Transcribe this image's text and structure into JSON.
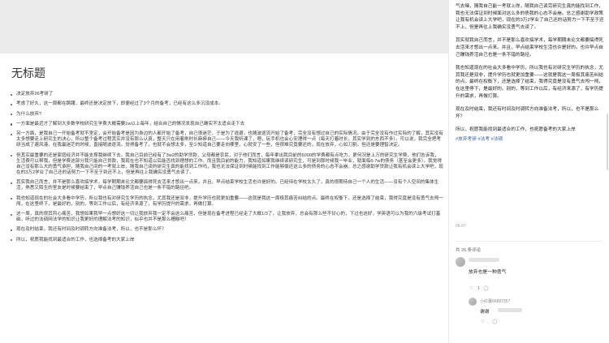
{
  "note": {
    "title": "无标题",
    "items": [
      "决定放弃26考研了",
      "考虑了好久，这一周都在踌躇，最终还是决定放下，即便经过了3个月的备考，已经有这么多沉没成本。",
      "为什么放弃?",
      "一方面是最近才了解到大多数学校研究生学费大概需要1w以上每年，结合自己的情况发现自己确实不太适合走下去",
      "另一方面，是我自己一开始备考就不坚定，会开始备考是因为身边的人都开始了备考，自己很迷茫，于是为了逃避，也随波逐流开始了备考，完全没有想过自己的实际情况。由于完全没有作过实际的了解，其实没有太多想要走上研究生的决心，所以整个备考过程其实并没有那么认真，整天只在用着刷时长麻痹自己——今天我听课了，嗯，玩手机也会心安理得一点（每天打着时长，其实学到的东西不多）。可以说，我完全把考研当成了避风港，在我最迷茫的时候，直接随波逐流。觉得备考了，也就不会想太多，至少知道自己要走向哪里，心就安了一些，但很难究竟要还的，现在放弃，心如刀割，但还是要理智决定。",
      "但其实最重要的还是家庭经济并不能支撑我继续下去。我自己目前已经有了3w2的助学贷款，父母都是农民，对于他们而言，每年拿出我目前的6000的学费都有点吃力，更何况是上万的研究生学费，他们告诉我，生活费可以帮我，但是学费这部分我只能自己贷款，我现在也不知道以后能否找到理想的工作。而且我目前的能力，我知道如果我继续读研究生，可是到那时候我一毕业，就面临6-7w的债务（甚至会更多）。我觉得自己没有那么大的勇气承担，随我自己间的一考就上岸，随我自己读的研究生真的能找到工作吗，我也无法保证到时候能找到工作能够偿还这么多的债务的心态不会崩。总之感谢助学贷款让我有机会读上大学吧，现在的3万2学业了自己还的话努力一下不至于到还不上，但是再往上我确实没勇气去读了。",
      "其实我自己而言，并不是那么喜欢搞学术，每学期期末论文都要搞得死去活来才憋出一点来。并且，早点结束学校生活也许是好的。已经待在学校太久了，真的很期待自己一个人的生活——没有个人空间的集体生活，熟悉又陌生的室友是时候要结束了，早点自己赚钱养活自己也是一条不错的路径吧。",
      "我也知道现在的社会大多看中学历，所以我也有对研究生学历的执念，尤其我还是双非，提升学历也就更加重要——这就是我这一周极其痛苦纠结的点。最终在权衡下，还是选择了结束，我得究竟是没有勇气去闯一闯，在这里终下，是最好的，别的，等到工作以后，有经济来源了，有学历提升的需求，再做打算。",
      "这一周，真的很其煎心痛苦，我想如果我早一点想好这一切让我放弃我一定不会这么痛苦，但是现在备考进程已经走了大概1/3了，让我放弃，总会有那么些不甘心的，下过也这好，学英语可以为我的六级考试打基础，听过的法硕网法学的知识让我更好的理解法考的知识，似乎也并不是那么槽糕吧！",
      "现在及时结束，我还有时间及时调转方向准备法考，所以，也不是那么坏？",
      "所以，祝愿我能找到最适合的工作，也选择备考的大家上岸"
    ]
  },
  "post": {
    "paragraphs": [
      "气去赌，随我自己能一考就上岸，随我自己读完研究生真的能找到工作，我也无法保证到时候面对这么多的债我的心态不会崩。总之感谢助学政策让我有机会读上大学吧，现在的3万2学业了自己还的话努力一下不至于还不上，但是再往上我确实没勇气去读了。",
      "其实就我自己而言，并不是那么喜欢搞学术，每学期期末论文都要搞得死去活来才憋出一点来。并且，早点结束学校生活也许是好的。也许早点自己赚钱养活自己也是一条不错的路径。",
      "我也知道现在的社会大多看中学历，所以我也有对研究生学历的执念，尤其我还是双非，提升学历也就更加重要——这就是我这一周极其痛苦纠结的点。最终在权衡下，还是选择了结束，我得究竟是没有勇气去闯一闯，在这里停下，是最好的。别的，等到工作以后，有经济来源了，有学历提升的需求，再做打算。",
      "现在及时结束，我还有时间及时调转方向准备法考，所以，也不是那么坏？",
      "所以，祝愿我能找到最适合的工作，也祝愿备考的大家上岸"
    ],
    "tags": "#放弃考研 #法考 #法硕",
    "date": "06-07",
    "comment_count": "共 26 条评论"
  },
  "comments": [
    {
      "text": "放弃也是一种勇气",
      "likes": "1"
    },
    {
      "name": "小红薯66887357",
      "text": "谢谢",
      "likes": ""
    }
  ],
  "colors": {
    "tag": "#3b5b9a",
    "background": "#ebebeb"
  },
  "icons": {
    "like": "heart-icon",
    "reply": "comment-icon"
  }
}
